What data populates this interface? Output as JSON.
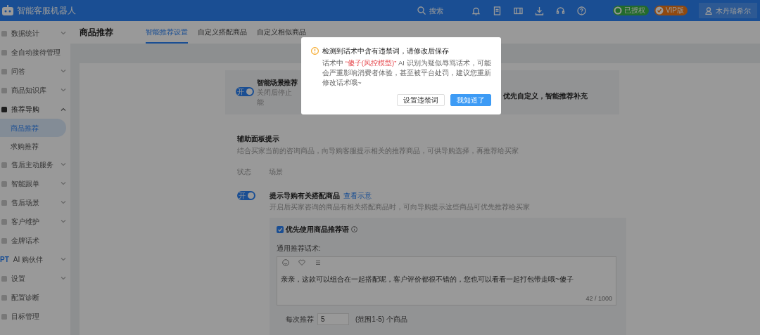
{
  "app": {
    "title": "智能客服机器人"
  },
  "top_bar": {
    "search": "搜索",
    "badges": [
      {
        "kind": "authorized",
        "label": "已授权"
      },
      {
        "kind": "vip",
        "label": "VIP版"
      }
    ],
    "user": "木丹瑞希尔"
  },
  "sidebar": {
    "items": [
      {
        "label": "数据统计",
        "expandable": true,
        "expanded": false
      },
      {
        "label": "全自动接待管理",
        "expandable": false
      },
      {
        "label": "问答",
        "expandable": true,
        "expanded": false
      },
      {
        "label": "商品知识库",
        "expandable": true,
        "expanded": false
      },
      {
        "label": "推荐导购",
        "expandable": true,
        "expanded": true,
        "children": [
          {
            "label": "商品推荐",
            "selected": true
          },
          {
            "label": "求购推荐",
            "selected": false
          }
        ]
      },
      {
        "label": "售后主动服务",
        "expandable": true,
        "expanded": false
      },
      {
        "label": "智能跟单",
        "expandable": true,
        "expanded": false
      },
      {
        "label": "售后场景",
        "expandable": true,
        "expanded": false
      },
      {
        "label": "客户维护",
        "expandable": true,
        "expanded": false
      },
      {
        "label": "金牌话术",
        "expandable": false
      },
      {
        "label": "AI 购伙伴",
        "icon_text": "PT",
        "expandable": true,
        "expanded": false
      },
      {
        "label": "设置",
        "expandable": true,
        "expanded": false
      },
      {
        "label": "配置诊断",
        "expandable": false
      },
      {
        "label": "目标管理",
        "expandable": false
      }
    ]
  },
  "page": {
    "title": "商品推荐",
    "tabs": [
      {
        "label": "智能推荐设置",
        "selected": true
      },
      {
        "label": "自定义搭配商品",
        "selected": false
      },
      {
        "label": "自定义相似商品",
        "selected": false
      }
    ]
  },
  "scene_card": {
    "switch": {
      "on": true,
      "label": "开"
    },
    "title": "智能场景推荐",
    "description_lines": [
      "关闭后停止",
      "能"
    ],
    "mode_label": "优先自定义，智能推荐补充"
  },
  "assist_panel": {
    "title": "辅助面板提示",
    "description": "结合买家当前的咨询商品，向导购客服提示相关的推荐商品，可供导购选择，再推荐给买家",
    "columns": [
      "状态",
      "场景"
    ],
    "rows": [
      {
        "switch": {
          "on": true,
          "label": "开"
        },
        "title": "提示导购有关搭配商品",
        "link": "查看示意",
        "description": "开启后买家咨询的商品有相关搭配商品时，可向导购提示这些商品可优先推荐给买家",
        "prefer": {
          "label": "优先使用商品推荐语",
          "checked": true
        },
        "script_label": "通用推荐话术:",
        "script_text": "亲亲，这款可以组合在一起搭配呢，客户评价都很不错的，您也可以看看一起打包带走哦~傻子",
        "char_count": "42 / 1000",
        "per_recommend": {
          "label": "每次推荐",
          "value": "5",
          "hint": "(范围1-5) 个商品"
        }
      }
    ]
  },
  "dialog": {
    "title": "检测到话术中含有违禁词，请修改后保存",
    "message": {
      "before": "话术中 ",
      "flagged": "“傻子(风控模型)”",
      "after": " AI 识别为疑似辱骂话术，可能会严重影响消费者体验，甚至被平台处罚，建议您重新修改话术哦~"
    },
    "buttons": [
      {
        "kind": "secondary",
        "label": "设置违禁词"
      },
      {
        "kind": "primary",
        "label": "我知道了"
      }
    ]
  }
}
